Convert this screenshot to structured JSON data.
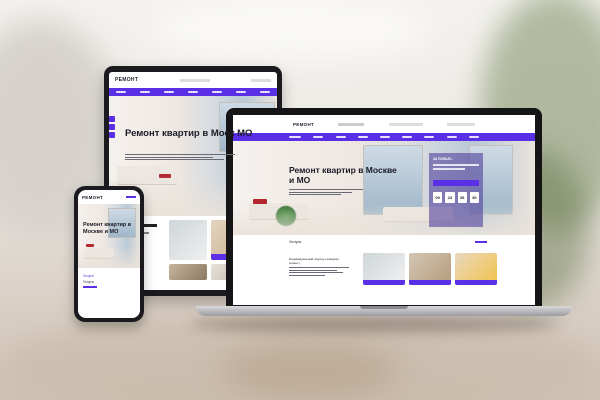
{
  "brand": {
    "logo": "РЕМОНТ",
    "accent": "#5a2fe6"
  },
  "hero": {
    "title": "Ремонт квартир в Москве и МО",
    "title_tablet": "Ремонт квартир в Моск МО"
  },
  "section": {
    "services_title": "Услуги",
    "card_heading": "Индивидуальный подход к каждому клиенту"
  },
  "offer": {
    "headline": "ЗА ПОЛЬЗУ...",
    "timer": [
      "00",
      "23",
      "35",
      "30"
    ]
  },
  "phone_menu": {
    "items": [
      "Услуги",
      "Услуги"
    ]
  }
}
